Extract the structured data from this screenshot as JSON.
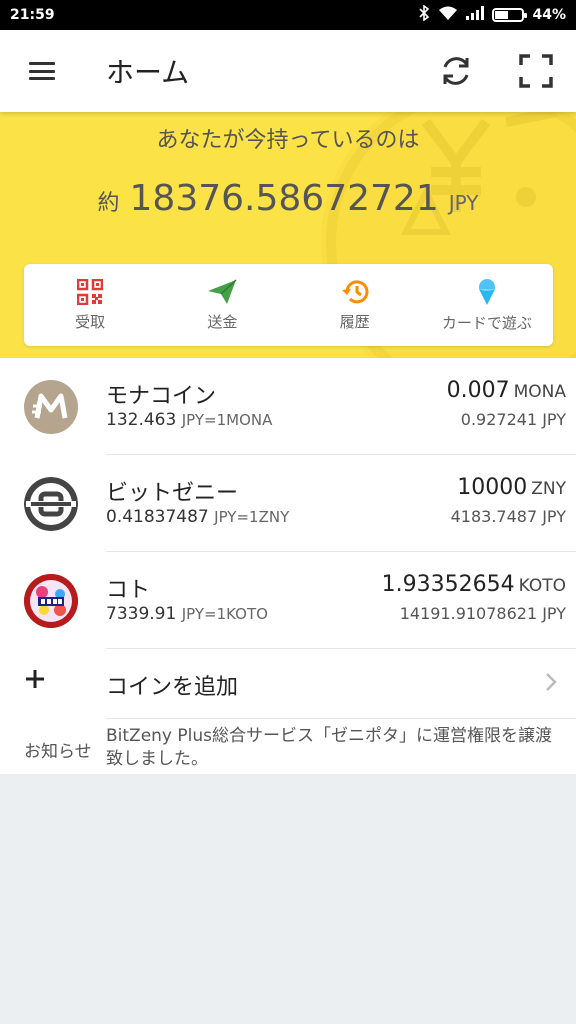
{
  "status_bar": {
    "time": "21:59",
    "battery": "44%",
    "battery_level": 0.44
  },
  "appbar": {
    "title": "ホーム",
    "menu_icon": "hamburger-menu-icon",
    "sync_icon": "sync-icon",
    "scan_icon": "qr-scan-icon"
  },
  "balance": {
    "label": "あなたが今持っているのは",
    "prefix": "約",
    "value": "18376.58672721",
    "unit": "JPY"
  },
  "actions": [
    {
      "label": "受取",
      "icon": "qr-code-icon",
      "color": "#e53935"
    },
    {
      "label": "送金",
      "icon": "send-plane-icon",
      "color": "#43a047"
    },
    {
      "label": "履歴",
      "icon": "history-icon",
      "color": "#fb8c00"
    },
    {
      "label": "カードで遊ぶ",
      "icon": "ice-cream-icon",
      "color": "#29b6f6"
    }
  ],
  "coins": [
    {
      "name": "モナコイン",
      "rate_value": "132.463",
      "rate_label": "JPY=1MONA",
      "amount": "0.007",
      "amount_unit": "MONA",
      "fiat": "0.927241 JPY",
      "logo": "monacoin-logo"
    },
    {
      "name": "ビットゼニー",
      "rate_value": "0.41837487",
      "rate_label": "JPY=1ZNY",
      "amount": "10000",
      "amount_unit": "ZNY",
      "fiat": "4183.7487 JPY",
      "logo": "bitzeny-logo"
    },
    {
      "name": "コト",
      "rate_value": "7339.91",
      "rate_label": "JPY=1KOTO",
      "amount": "1.93352654",
      "amount_unit": "KOTO",
      "fiat": "14191.91078621 JPY",
      "logo": "koto-logo"
    }
  ],
  "add_coin": {
    "label": "コインを追加"
  },
  "notice": {
    "label": "お知らせ",
    "text": "BitZeny Plus総合サービス「ゼニポタ」に運営権限を譲渡致しました。"
  },
  "colors": {
    "header_yellow": "#fbe247",
    "background": "#eceff1"
  }
}
